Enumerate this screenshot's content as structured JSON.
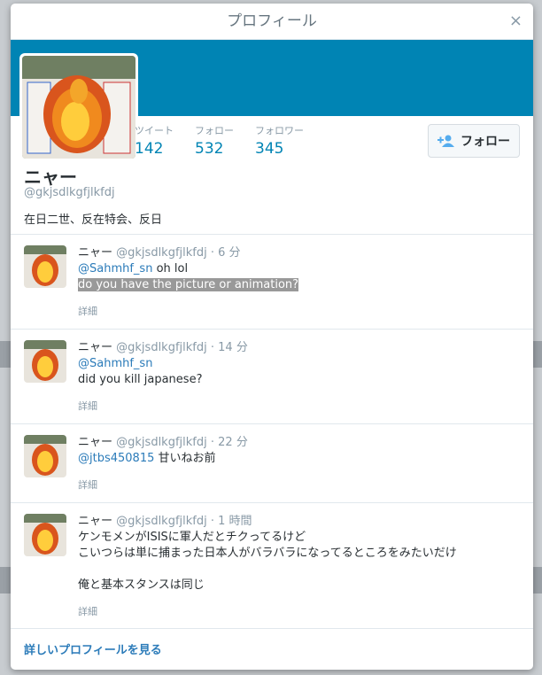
{
  "modal": {
    "title": "プロフィール",
    "close_label": "×"
  },
  "profile": {
    "name": "ニャー",
    "handle": "@gkjsdlkgfjlkfdj",
    "bio": "在日二世、反在特会、反日",
    "follow_label": "フォロー",
    "stats": [
      {
        "label": "ツイート",
        "value": "142"
      },
      {
        "label": "フォロー",
        "value": "532"
      },
      {
        "label": "フォロワー",
        "value": "345"
      }
    ]
  },
  "tweets": [
    {
      "name": "ニャー",
      "handle": "@gkjsdlkgfjlkfdj",
      "time": "6 分",
      "mention": "@Sahmhf_sn",
      "text": "oh lol",
      "highlight": "do you have the picture or animation?",
      "details": "詳細"
    },
    {
      "name": "ニャー",
      "handle": "@gkjsdlkgfjlkfdj",
      "time": "14 分",
      "mention": "@Sahmhf_sn",
      "text": "did you kill japanese?",
      "details": "詳細"
    },
    {
      "name": "ニャー",
      "handle": "@gkjsdlkgfjlkfdj",
      "time": "22 分",
      "mention": "@jtbs450815",
      "text": "甘いねお前",
      "details": "詳細"
    },
    {
      "name": "ニャー",
      "handle": "@gkjsdlkgfjlkfdj",
      "time": "1 時間",
      "line1": "ケンモメンがISISに軍人だとチクってるけど",
      "line2": "こいつらは単に捕まった日本人がバラバラになってるところをみたいだけ",
      "line3": "俺と基本スタンスは同じ",
      "details": "詳細"
    }
  ],
  "footer": {
    "link_label": "詳しいプロフィールを見る"
  }
}
